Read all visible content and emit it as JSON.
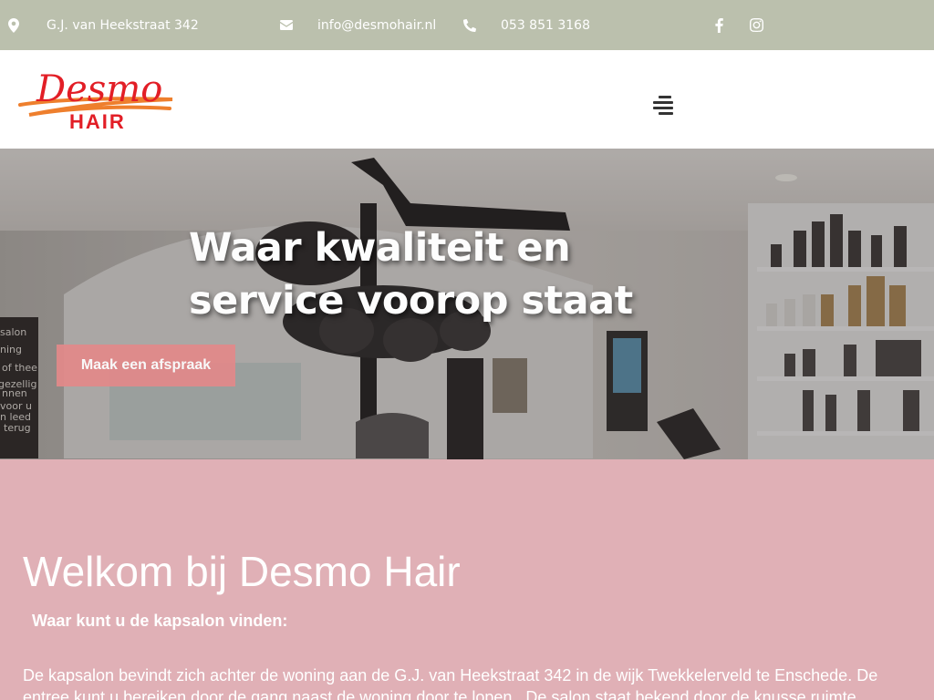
{
  "topbar": {
    "address": "G.J. van Heekstraat 342",
    "email": "info@desmohair.nl",
    "phone": "053 851 3168",
    "icons": [
      "map-marker-icon",
      "envelope-icon",
      "phone-icon",
      "facebook-icon",
      "instagram-icon"
    ]
  },
  "header": {
    "logo_line1": "Desmo",
    "logo_line2": "HAIR",
    "menu_icon": "hamburger-menu-icon"
  },
  "hero": {
    "title": "Waar kwaliteit en service voorop staat",
    "cta_label": "Maak een afspraak",
    "chalkboard_lines": [
      "salon",
      "ning",
      "of thee",
      "gezellig",
      "nnen",
      "voor u",
      "n leed",
      "terug"
    ]
  },
  "welcome": {
    "heading": "Welkom bij Desmo Hair",
    "subheading": "Waar kunt u de kapsalon vinden:",
    "body": "De kapsalon bevindt zich achter de woning aan de G.J. van Heekstraat 342 in de wijk Twekkelerveld te Enschede. De entree kunt u bereiken door de gang naast de woning door te lopen . De salon staat bekend door de knusse ruimte."
  },
  "colors": {
    "topbar_bg": "#bbc0ad",
    "accent_pink": "#e0b0b6",
    "cta_bg": "#e2898a",
    "logo_red": "#e21e26",
    "logo_orange": "#ee7f2d"
  }
}
